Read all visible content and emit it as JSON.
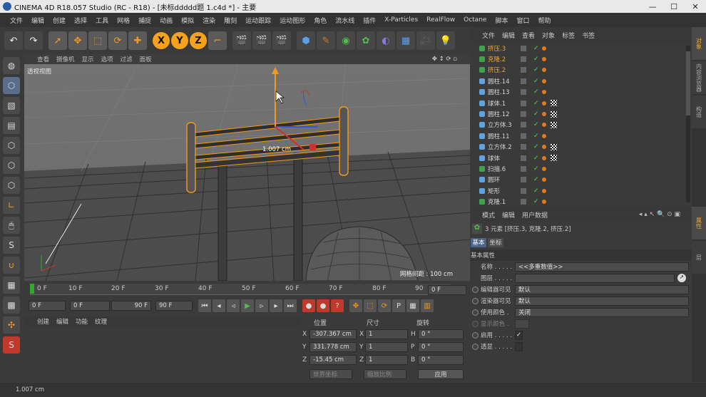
{
  "window": {
    "title": "CINEMA 4D R18.057 Studio (RC - R18) - [未标ddddd题 1.c4d *] - 主要"
  },
  "menu": [
    "文件",
    "编辑",
    "创建",
    "选择",
    "工具",
    "网格",
    "捕捉",
    "动画",
    "模拟",
    "渲染",
    "雕刻",
    "运动跟踪",
    "运动图形",
    "角色",
    "流水线",
    "插件",
    "X-Particles",
    "RealFlow",
    "Octane",
    "脚本",
    "窗口",
    "帮助"
  ],
  "viewport": {
    "menu": [
      "查看",
      "摄像机",
      "显示",
      "选项",
      "过滤",
      "面板"
    ],
    "label": "透视视图",
    "measure": "1.007 cm",
    "grid_info": "网格间距 : 100 cm"
  },
  "timeline": {
    "ticks": [
      "0 F",
      "10 F",
      "20 F",
      "30 F",
      "40 F",
      "50 F",
      "60 F",
      "70 F",
      "80 F",
      "90"
    ],
    "current_field": "0 F"
  },
  "transport": {
    "start": "0 F",
    "min": "0 F",
    "max": "90 F",
    "end": "90 F"
  },
  "material": {
    "menu": [
      "创建",
      "编辑",
      "功能",
      "纹理"
    ]
  },
  "coords": {
    "headers": [
      "位置",
      "尺寸",
      "旋转"
    ],
    "rows": [
      {
        "axis": "X",
        "pos": "-307.367 cm",
        "saxis": "X",
        "size": "1",
        "raxis": "H",
        "rot": "0 °"
      },
      {
        "axis": "Y",
        "pos": "331.778 cm",
        "saxis": "Y",
        "size": "1",
        "raxis": "P",
        "rot": "0 °"
      },
      {
        "axis": "Z",
        "pos": "-15.45 cm",
        "saxis": "Z",
        "size": "1",
        "raxis": "B",
        "rot": "0 °"
      }
    ],
    "mode": "世界坐标",
    "scale_mode": "缩放比例",
    "apply": "应用"
  },
  "objects": {
    "menu": [
      "文件",
      "编辑",
      "查看",
      "对象",
      "标签",
      "书签"
    ],
    "rows": [
      {
        "name": "挤压.3",
        "sel": true,
        "icon": "#3fa34d",
        "tag": "none"
      },
      {
        "name": "克隆.2",
        "sel": true,
        "icon": "#3fa34d",
        "tag": "none"
      },
      {
        "name": "挤压.2",
        "sel": true,
        "icon": "#3fa34d",
        "tag": "none"
      },
      {
        "name": "圆柱.14",
        "sel": false,
        "icon": "#5da3e0",
        "tag": "none"
      },
      {
        "name": "圆柱.13",
        "sel": false,
        "icon": "#5da3e0",
        "tag": "none"
      },
      {
        "name": "球体.1",
        "sel": false,
        "icon": "#5da3e0",
        "tag": "check"
      },
      {
        "name": "圆柱.12",
        "sel": false,
        "icon": "#5da3e0",
        "tag": "check"
      },
      {
        "name": "立方体.3",
        "sel": false,
        "icon": "#5da3e0",
        "tag": "check"
      },
      {
        "name": "圆柱.11",
        "sel": false,
        "icon": "#5da3e0",
        "tag": "none"
      },
      {
        "name": "立方体.2",
        "sel": false,
        "icon": "#5da3e0",
        "tag": "check"
      },
      {
        "name": "球体",
        "sel": false,
        "icon": "#5da3e0",
        "tag": "check"
      },
      {
        "name": "扫描.6",
        "sel": false,
        "icon": "#3fa34d",
        "tag": "none"
      },
      {
        "name": "圆环",
        "sel": false,
        "icon": "#5da3e0",
        "tag": "none"
      },
      {
        "name": "矩形",
        "sel": false,
        "icon": "#5da3e0",
        "tag": "none"
      },
      {
        "name": "克隆.1",
        "sel": false,
        "icon": "#3fa34d",
        "tag": "none"
      }
    ]
  },
  "attributes": {
    "menu": [
      "模式",
      "编辑",
      "用户数据"
    ],
    "info": "3 元素 [挤压.3, 克隆.2, 挤压.2]",
    "tabs": [
      "基本",
      "坐标"
    ],
    "section": "基本属性",
    "fields": [
      {
        "label": "名称 . . . . .",
        "value": "<<多重数值>>"
      },
      {
        "label": "图层 . . . . .",
        "value": ""
      },
      {
        "label": "编辑器可见",
        "value": "默认"
      },
      {
        "label": "渲染器可见",
        "value": "默认"
      },
      {
        "label": "使用颜色 .",
        "value": "关闭"
      },
      {
        "label": "显示颜色 .",
        "value": ""
      },
      {
        "label": "启用 . . . . .",
        "value": "✓"
      },
      {
        "label": "透显 . . . . .",
        "value": ""
      }
    ]
  },
  "side_tabs": [
    "对象",
    "内容浏览器",
    "构造",
    "属性",
    "层"
  ],
  "status": "1.007 cm",
  "colors": {
    "accent": "#f5a623",
    "selection": "#f5a623"
  }
}
